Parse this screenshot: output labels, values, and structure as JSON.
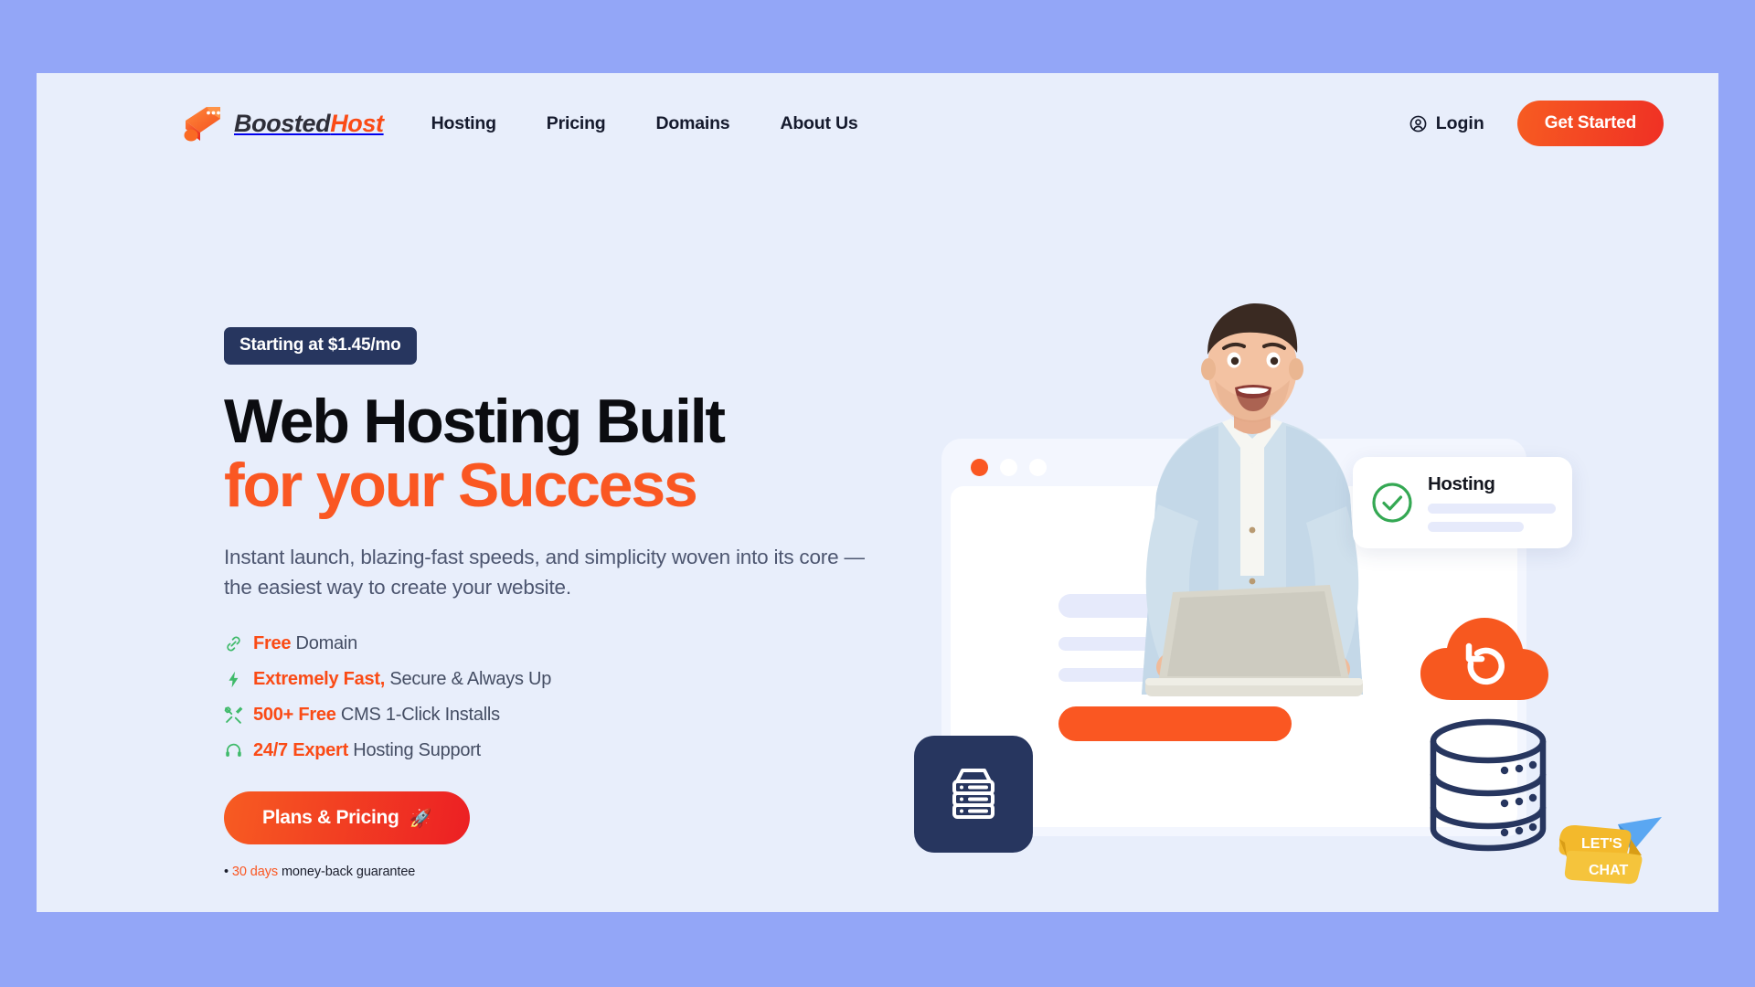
{
  "theme": {
    "outer_background": "#93a6f7",
    "panel_background": "#e8eefb",
    "accent_orange": "#fa4b16",
    "accent_orange_light": "#fa5722",
    "navy": "#27365f",
    "green": "#34a853",
    "text_dark": "#151a2d",
    "text_muted": "#4d5670",
    "chat_yellow": "#f4b72b",
    "plane_blue": "#4a9ef0"
  },
  "header": {
    "brand": {
      "name_part1": "Boosted",
      "name_part2": "Host",
      "logo_icon": "rocket-logo-icon"
    },
    "nav": [
      {
        "label": "Hosting"
      },
      {
        "label": "Pricing"
      },
      {
        "label": "Domains"
      },
      {
        "label": "About Us"
      }
    ],
    "login": {
      "label": "Login",
      "icon": "user-circle-icon"
    },
    "cta": {
      "label": "Get Started"
    }
  },
  "hero": {
    "badge": "Starting at $1.45/mo",
    "headline_line1": "Web Hosting Built",
    "headline_line2": "for your Success",
    "subheadline": "Instant launch, blazing-fast speeds, and simplicity woven into its core — the easiest way to create your website.",
    "features": [
      {
        "icon": "link-icon",
        "strong": "Free",
        "rest": " Domain"
      },
      {
        "icon": "bolt-icon",
        "strong": "Extremely Fast,",
        "rest": " Secure & Always Up"
      },
      {
        "icon": "tools-icon",
        "strong": "500+ Free",
        "rest": " CMS 1-Click Installs"
      },
      {
        "icon": "headset-icon",
        "strong": "24/7 Expert",
        "rest": " Hosting Support"
      }
    ],
    "cta": {
      "label": "Plans & Pricing",
      "icon": "rocket-icon",
      "glyph": "🚀"
    },
    "guarantee": {
      "bullet": "•",
      "days": "30 days",
      "rest": " money-back guarantee"
    }
  },
  "illustration": {
    "browser_mock": {
      "traffic_dots": [
        "orange",
        "white",
        "white"
      ],
      "cta_bar_color": "#fa5722"
    },
    "hosting_card": {
      "title": "Hosting",
      "status_icon": "check-circle-icon"
    },
    "icons": [
      {
        "name": "cloud-sync-icon",
        "color": "#fa5722"
      },
      {
        "name": "database-icon",
        "color": "#27365f"
      },
      {
        "name": "server-stack-icon",
        "color": "#ffffff"
      }
    ]
  },
  "chat_widget": {
    "line1": "LET'S",
    "line2": "CHAT",
    "icon": "paper-plane-icon"
  }
}
